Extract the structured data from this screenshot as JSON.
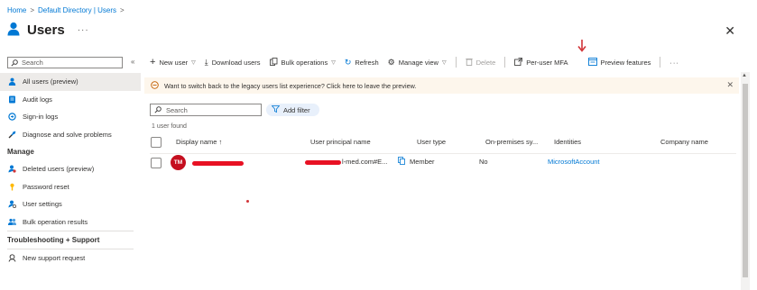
{
  "breadcrumb": {
    "home": "Home",
    "directory": "Default Directory | Users",
    "sep": ">"
  },
  "header": {
    "title": "Users",
    "more": "···",
    "close": "✕"
  },
  "sidebar": {
    "search_placeholder": "Search",
    "collapse": "«",
    "items": [
      {
        "label": "All users (preview)",
        "icon": "user-icon"
      },
      {
        "label": "Audit logs",
        "icon": "document-icon"
      },
      {
        "label": "Sign-in logs",
        "icon": "sign-in-icon"
      },
      {
        "label": "Diagnose and solve problems",
        "icon": "wrench-icon"
      }
    ],
    "manage_heading": "Manage",
    "manage_items": [
      {
        "label": "Deleted users (preview)",
        "icon": "deleted-users-icon"
      },
      {
        "label": "Password reset",
        "icon": "key-icon"
      },
      {
        "label": "User settings",
        "icon": "settings-icon"
      },
      {
        "label": "Bulk operation results",
        "icon": "bulk-results-icon"
      }
    ],
    "support_heading": "Troubleshooting + Support",
    "support_items": [
      {
        "label": "New support request",
        "icon": "support-icon"
      }
    ]
  },
  "toolbar": {
    "new_user": "New user",
    "download_users": "Download users",
    "bulk_operations": "Bulk operations",
    "refresh": "Refresh",
    "manage_view": "Manage view",
    "delete": "Delete",
    "per_user_mfa": "Per-user MFA",
    "preview_features": "Preview features",
    "more": "···"
  },
  "banner": {
    "text": "Want to switch back to the legacy users list experience? Click here to leave the preview.",
    "close": "✕"
  },
  "list": {
    "search_placeholder": "Search",
    "add_filter": "Add filter",
    "count": "1 user found",
    "columns": {
      "display_name": "Display name ↑",
      "upn": "User principal name",
      "user_type": "User type",
      "on_prem": "On-premises sy...",
      "identities": "Identities",
      "company": "Company name"
    },
    "rows": [
      {
        "initials": "TM",
        "upn_suffix": "l-med.com#E...",
        "user_type": "Member",
        "on_prem": "No",
        "identities": "MicrosoftAccount"
      }
    ]
  },
  "colors": {
    "accent": "#0078d4",
    "avatar": "#c50f1f",
    "redaction": "#e81123",
    "banner_bg": "#fdf6ec"
  }
}
